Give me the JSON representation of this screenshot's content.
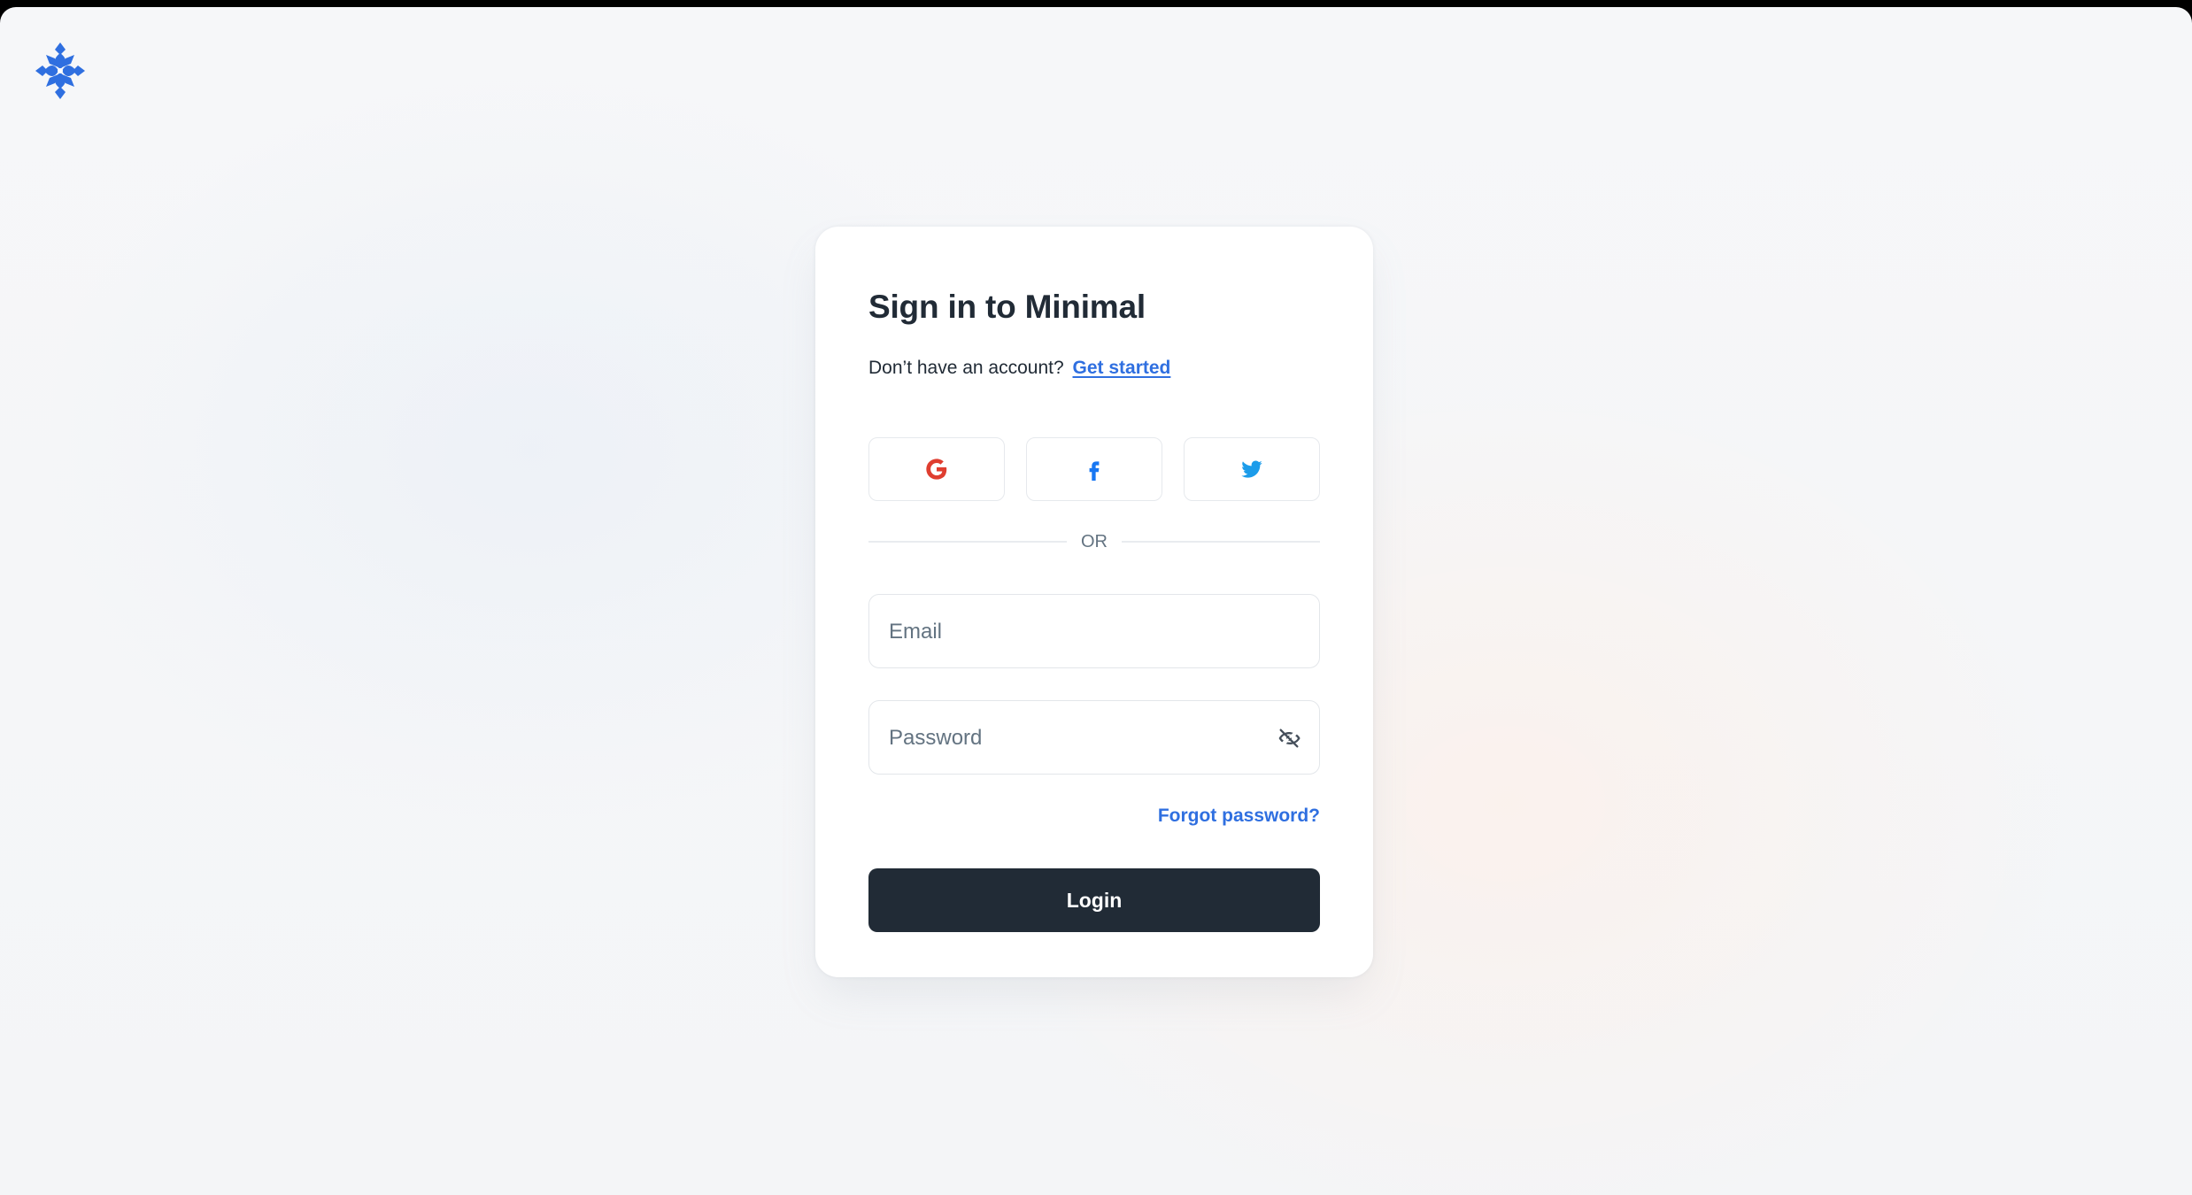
{
  "app": {
    "logo_icon": "snowflake-logo-icon",
    "brand_color": "#2f6fe0"
  },
  "signin": {
    "title": "Sign in to Minimal",
    "subtitle_prefix": "Don’t have an account?",
    "get_started_label": "Get started"
  },
  "social": {
    "google_icon": "google-icon",
    "facebook_icon": "facebook-icon",
    "twitter_icon": "twitter-icon",
    "google_color": "#df3e30",
    "facebook_color": "#1877f2",
    "twitter_color": "#1c9cea"
  },
  "divider": {
    "label": "OR"
  },
  "form": {
    "email_placeholder": "Email",
    "email_value": "",
    "password_placeholder": "Password",
    "password_value": "",
    "password_toggle_icon": "eye-off-icon",
    "forgot_label": "Forgot password?",
    "login_label": "Login",
    "login_color": "#212b36"
  }
}
